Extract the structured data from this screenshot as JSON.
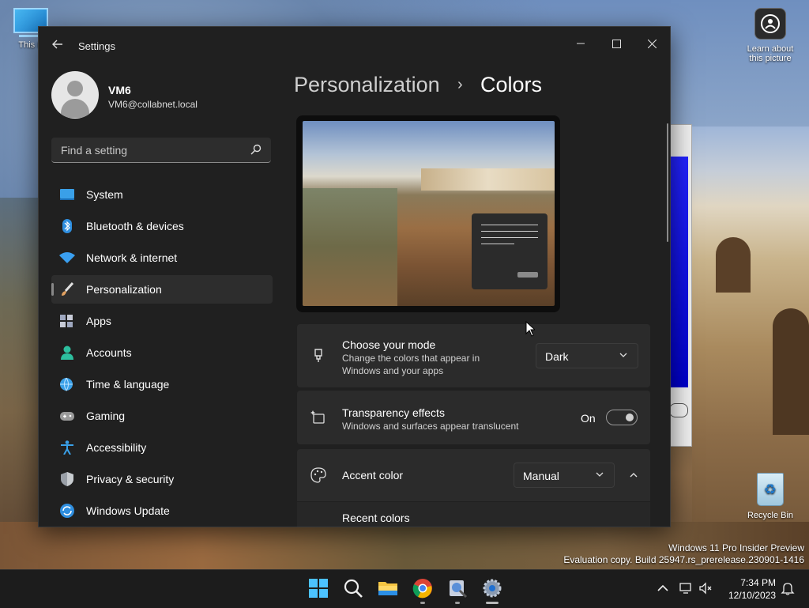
{
  "desktop": {
    "this_pc_label": "This P",
    "learn_label_line1": "Learn about",
    "learn_label_line2": "this picture",
    "recycle_label": "Recycle Bin",
    "watermark_line1": "Windows 11 Pro Insider Preview",
    "watermark_line2": "Evaluation copy. Build 25947.rs_prerelease.230901-1416"
  },
  "window": {
    "title": "Settings",
    "controls": {
      "minimize": "minimize-icon",
      "maximize": "maximize-icon",
      "close": "close-icon"
    }
  },
  "user": {
    "name": "VM6",
    "email": "VM6@collabnet.local"
  },
  "search": {
    "placeholder": "Find a setting"
  },
  "nav": {
    "items": [
      {
        "label": "System",
        "icon": "system-icon",
        "color": "#3aa0e8"
      },
      {
        "label": "Bluetooth & devices",
        "icon": "bluetooth-icon",
        "color": "#2f8fe0"
      },
      {
        "label": "Network & internet",
        "icon": "wifi-icon",
        "color": "#3a9ff0"
      },
      {
        "label": "Personalization",
        "icon": "brush-icon",
        "color": "#e0a060",
        "active": true
      },
      {
        "label": "Apps",
        "icon": "apps-icon",
        "color": "#9fa8c0"
      },
      {
        "label": "Accounts",
        "icon": "accounts-icon",
        "color": "#2dbf9f"
      },
      {
        "label": "Time & language",
        "icon": "globe-clock-icon",
        "color": "#3aa0e8"
      },
      {
        "label": "Gaming",
        "icon": "gamepad-icon",
        "color": "#9a9a9a"
      },
      {
        "label": "Accessibility",
        "icon": "accessibility-icon",
        "color": "#3aa0e8"
      },
      {
        "label": "Privacy & security",
        "icon": "shield-icon",
        "color": "#9aa0a8"
      },
      {
        "label": "Windows Update",
        "icon": "update-icon",
        "color": "#2f8fe0"
      }
    ]
  },
  "breadcrumb": {
    "parent": "Personalization",
    "separator": "›",
    "current": "Colors"
  },
  "mode_card": {
    "title": "Choose your mode",
    "desc": "Change the colors that appear in Windows and your apps",
    "value": "Dark"
  },
  "transparency_card": {
    "title": "Transparency effects",
    "desc": "Windows and surfaces appear translucent",
    "state_label": "On",
    "state": true
  },
  "accent_card": {
    "title": "Accent color",
    "value": "Manual",
    "expanded": true
  },
  "recent_colors": {
    "label": "Recent colors"
  },
  "taskbar": {
    "icons": [
      "windows-start-icon",
      "search-icon",
      "file-explorer-icon",
      "chrome-icon",
      "app-icon",
      "settings-icon"
    ],
    "clock_time": "7:34 PM",
    "clock_date": "12/10/2023"
  },
  "colors": {
    "window_bg": "#202020",
    "card_bg": "#2b2b2b",
    "accent_blue": "#3aa0e8"
  }
}
